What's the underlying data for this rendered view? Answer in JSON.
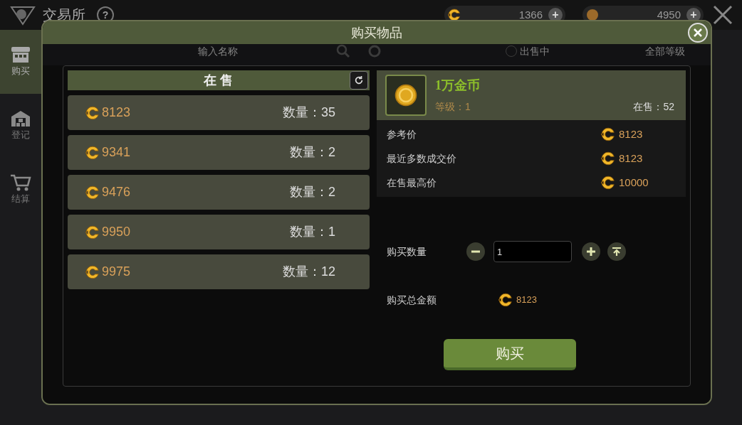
{
  "header": {
    "title": "交易所",
    "help": "?",
    "currencies": [
      {
        "amount": "1366",
        "plus": "+"
      },
      {
        "amount": "4950",
        "plus": "+"
      }
    ]
  },
  "sidebar": {
    "items": [
      {
        "label": "购买",
        "kind": "shop",
        "selected": true
      },
      {
        "label": "登记",
        "kind": "register",
        "selected": false
      },
      {
        "label": "结算",
        "kind": "cart",
        "selected": false
      }
    ]
  },
  "filter_bar": {
    "search": {
      "placeholder": "输入名称"
    },
    "on_sale": {
      "label": "出售中",
      "checked": false
    },
    "level": "全部等级"
  },
  "dialog": {
    "title": "购买物品",
    "listing": {
      "title": "在 售",
      "rows": [
        {
          "price": "8123",
          "quantity": "数量：35"
        },
        {
          "price": "9341",
          "quantity": "数量：2"
        },
        {
          "price": "9476",
          "quantity": "数量：2"
        },
        {
          "price": "9950",
          "quantity": "数量：1"
        },
        {
          "price": "9975",
          "quantity": "数量：12"
        }
      ]
    },
    "item": {
      "name": "1万金币",
      "level": "等级：1",
      "on_sale": "在售：52"
    },
    "prices": [
      {
        "label": "参考价",
        "value": "8123"
      },
      {
        "label": "最近多数成交价",
        "value": "8123"
      },
      {
        "label": "在售最高价",
        "value": "10000"
      }
    ],
    "quantity": {
      "label": "购买数量",
      "value": "1"
    },
    "total": {
      "label": "购买总金额",
      "value": "8123"
    },
    "buy_button": "购买"
  }
}
